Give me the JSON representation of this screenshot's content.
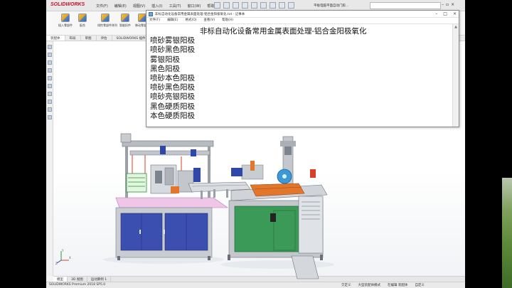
{
  "solidworks": {
    "logo": "SOLIDWORKS",
    "menus": [
      "文件(F)",
      "编辑(E)",
      "视图(V)",
      "插入(I)",
      "工具(T)",
      "窗口(W)",
      "帮助(H)"
    ],
    "doc_name": "平板电脑平面自动门胶...",
    "ribbon": [
      {
        "label": "插入零部件",
        "icon": "insert-component-icon"
      },
      {
        "label": "配合",
        "icon": "mate-icon"
      },
      {
        "label": "线性零部件阵列",
        "icon": "linear-pattern-icon"
      },
      {
        "label": "智能扣件",
        "icon": "smart-fastener-icon"
      },
      {
        "label": "移动零部件",
        "icon": "move-component-icon"
      },
      {
        "label": "显示隐藏零部件",
        "icon": "show-hidden-icon"
      }
    ],
    "tabs": [
      "装配体",
      "布局",
      "草图",
      "评估",
      "SOLIDWORKS 插件",
      "SOLIDWORKS MBD"
    ],
    "bottom_tabs": [
      "模型",
      "3D 视图",
      "运动算例 1"
    ],
    "status_left": "SOLIDWORKS Premium 2018 SP5.0",
    "status_items": [
      "欠定义",
      "大型装配体模式",
      "在编辑 装配体",
      "自定义"
    ],
    "triad_labels": [
      "X",
      "Y",
      "Z"
    ]
  },
  "notepad": {
    "title": "非标自动化设备常用金属表面处理-铝合金阳极氧化.txt - 记事本",
    "menus": [
      "文件(F)",
      "编辑(E)",
      "格式(O)",
      "查看(V)",
      "帮助(H)"
    ],
    "lines": [
      "非标自动化设备常用金属表面处理-铝合金阳极氧化",
      "喷砂雾银阳极",
      "喷砂黑色阳极",
      "雾银阳极",
      "黑色阳极",
      "喷砂本色阳极",
      "喷砂黑色阳极",
      "喷砂亮银阳极",
      "黑色硬质阳极",
      "本色硬质阳极"
    ]
  },
  "colors": {
    "cabinet_blue": "#3b4fb0",
    "cabinet_green": "#3b9a57",
    "frame_gray": "#9aa0a6",
    "accent_red": "#d8402a",
    "accent_orange": "#e2762b",
    "accent_pink": "#f0c6e8"
  }
}
